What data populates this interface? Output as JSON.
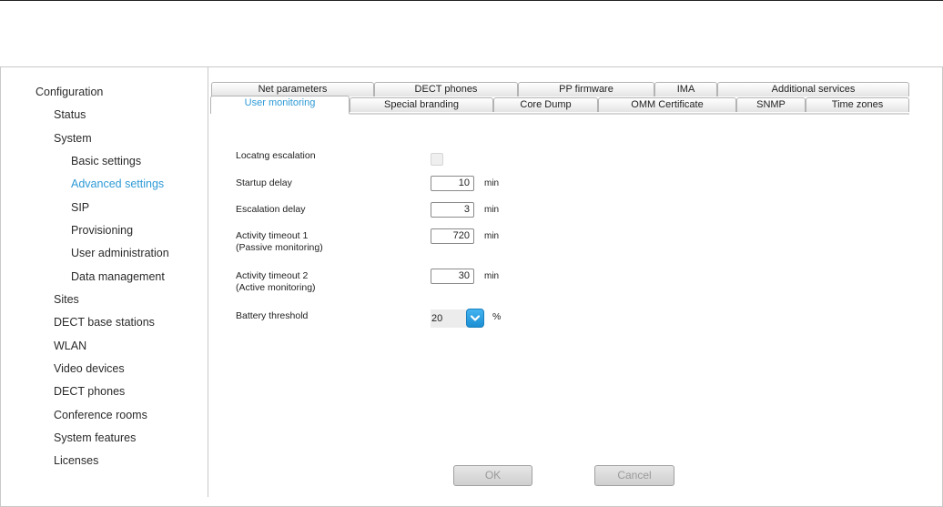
{
  "sidebar": {
    "root": "Configuration",
    "items": [
      {
        "label": "Status"
      },
      {
        "label": "System"
      },
      {
        "label": "Basic settings"
      },
      {
        "label": "Advanced settings"
      },
      {
        "label": "SIP"
      },
      {
        "label": "Provisioning"
      },
      {
        "label": "User administration"
      },
      {
        "label": "Data management"
      },
      {
        "label": "Sites"
      },
      {
        "label": "DECT base stations"
      },
      {
        "label": "WLAN"
      },
      {
        "label": "Video devices"
      },
      {
        "label": "DECT phones"
      },
      {
        "label": "Conference rooms"
      },
      {
        "label": "System features"
      },
      {
        "label": "Licenses"
      }
    ],
    "active": "Advanced settings"
  },
  "tabs": {
    "row1": [
      "Net parameters",
      "DECT phones",
      "PP firmware",
      "IMA",
      "Additional services"
    ],
    "row2": [
      "User monitoring",
      "Special branding",
      "Core Dump",
      "OMM Certificate",
      "SNMP",
      "Time zones"
    ],
    "active": "User monitoring"
  },
  "form": {
    "locating_escalation": {
      "label": "Locatng escalation",
      "checked": false
    },
    "startup_delay": {
      "label": "Startup delay",
      "value": "10",
      "unit": "min"
    },
    "escalation_delay": {
      "label": "Escalation delay",
      "value": "3",
      "unit": "min"
    },
    "activity_timeout_1": {
      "label": "Activity timeout 1",
      "sublabel": "(Passive monitoring)",
      "value": "720",
      "unit": "min"
    },
    "activity_timeout_2": {
      "label": "Activity timeout 2",
      "sublabel": "(Active monitoring)",
      "value": "30",
      "unit": "min"
    },
    "battery_threshold": {
      "label": "Battery threshold",
      "value": "20",
      "unit": "%"
    }
  },
  "buttons": {
    "ok": "OK",
    "cancel": "Cancel"
  },
  "colors": {
    "accent": "#2e9ad6",
    "select_button": "#1b8fd2"
  }
}
